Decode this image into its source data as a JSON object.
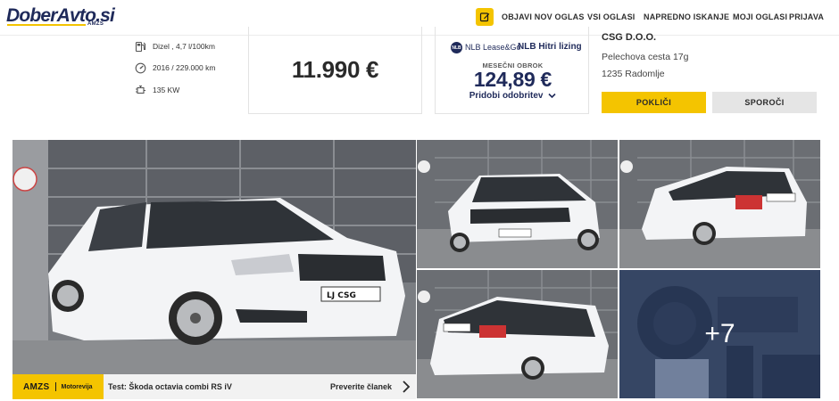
{
  "header": {
    "logo_text": "DoberAvto.si",
    "logo_sub": "AMZS",
    "nav": [
      {
        "label": "OBJAVI NOV OGLAS"
      },
      {
        "label": "VSI OGLASI"
      },
      {
        "label": "NAPREDNO ISKANJE"
      },
      {
        "label": "MOJI OGLASI"
      },
      {
        "label": "PRIJAVA"
      }
    ],
    "icons": {
      "new_ad": "edit-icon"
    }
  },
  "specs": [
    {
      "icon": "fuel-pump-icon",
      "text": "Dizel , 4,7 l/100km"
    },
    {
      "icon": "speedometer-icon",
      "text": "2016 / 229.000 km"
    },
    {
      "icon": "engine-icon",
      "text": "135 KW"
    }
  ],
  "price": {
    "value": "11.990 €"
  },
  "leasing": {
    "provider_badge": "nlb",
    "provider_name": "NLB Lease&Go",
    "product": "NLB Hitri lizing",
    "rate_label": "MESEČNI OBROK",
    "rate_value": "124,89 €",
    "cta": "Pridobi odobritev"
  },
  "dealer": {
    "name": "CSG d.o.o.",
    "address_line1": "Pelechova cesta 17g",
    "address_line2": "1235 Radomlje",
    "call_label": "POKLIČI",
    "message_label": "SPOROČI"
  },
  "gallery": {
    "more_count": "+7",
    "plate_text": "LJ CSG"
  },
  "banner": {
    "brand": "AMZS",
    "brand_sub": "Motorevija",
    "title": "Test: Škoda octavia combi RS iV",
    "cta": "Preverite članek"
  },
  "colors": {
    "accent_yellow": "#f4c400",
    "navy": "#1f2a5a",
    "car_white": "#f3f4f6"
  }
}
